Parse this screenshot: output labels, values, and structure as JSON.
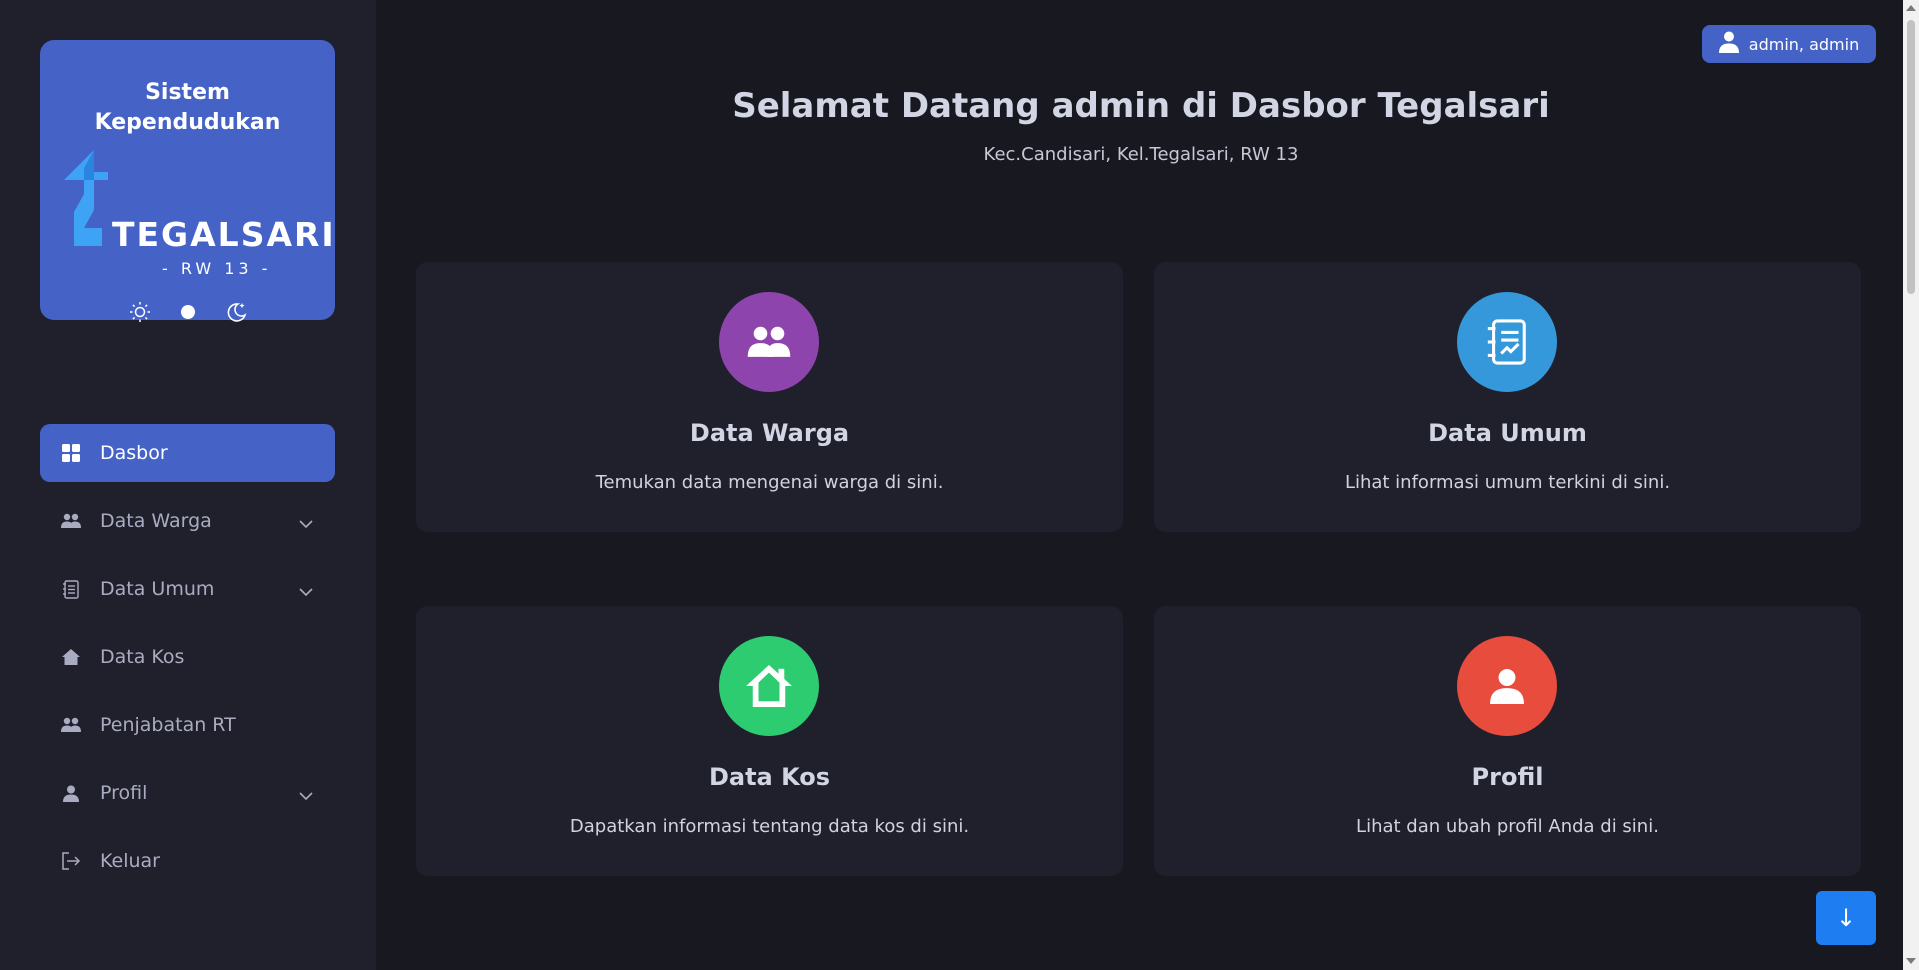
{
  "sidebar": {
    "brand": {
      "title_line1": "Sistem",
      "title_line2": "Kependudukan",
      "logo_name": "TEGALSARI",
      "logo_sub": "- RW 13 -"
    },
    "theme_icons": [
      "sun-icon",
      "dot-icon",
      "moon-stars-icon"
    ],
    "items": [
      {
        "label": "Dasbor",
        "icon": "dashboard-grid-icon",
        "active": true,
        "has_dropdown": false
      },
      {
        "label": "Data Warga",
        "icon": "users-icon",
        "active": false,
        "has_dropdown": true
      },
      {
        "label": "Data Umum",
        "icon": "document-icon",
        "active": false,
        "has_dropdown": true
      },
      {
        "label": "Data Kos",
        "icon": "house-icon",
        "active": false,
        "has_dropdown": false
      },
      {
        "label": "Penjabatan RT",
        "icon": "users-icon",
        "active": false,
        "has_dropdown": false
      },
      {
        "label": "Profil",
        "icon": "user-icon",
        "active": false,
        "has_dropdown": true
      },
      {
        "label": "Keluar",
        "icon": "logout-icon",
        "active": false,
        "has_dropdown": false
      }
    ]
  },
  "header": {
    "user_button": "admin, admin",
    "welcome": "Selamat Datang admin di Dasbor Tegalsari",
    "address": "Kec.Candisari, Kel.Tegalsari, RW 13"
  },
  "cards": [
    {
      "title": "Data Warga",
      "description": "Temukan data mengenai warga di sini.",
      "color": "#8e44ad",
      "icon": "users-icon"
    },
    {
      "title": "Data Umum",
      "description": "Lihat informasi umum terkini di sini.",
      "color": "#3498db",
      "icon": "document-icon"
    },
    {
      "title": "Data Kos",
      "description": "Dapatkan informasi tentang data kos di sini.",
      "color": "#2ecc71",
      "icon": "house-icon"
    },
    {
      "title": "Profil",
      "description": "Lihat dan ubah profil Anda di sini.",
      "color": "#e74c3c",
      "icon": "user-icon"
    }
  ],
  "scroll_down_button": "↓",
  "colors": {
    "accent": "#4562c7",
    "background": "#181820",
    "panel": "#20202d",
    "scroll_button": "#1f7df2"
  }
}
